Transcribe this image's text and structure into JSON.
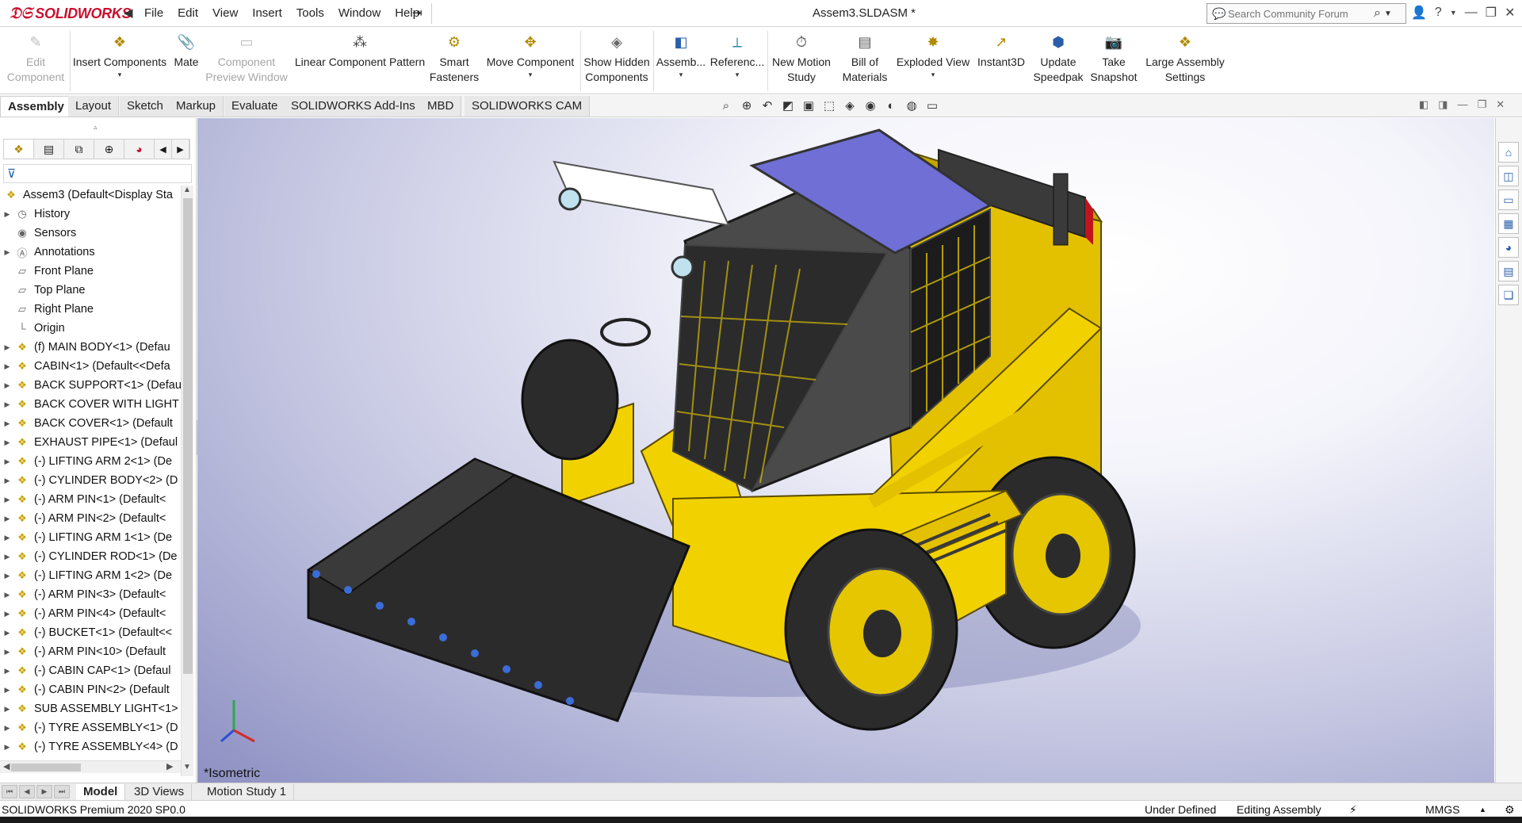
{
  "app": {
    "logo_text": "SOLIDWORKS",
    "document_title": "Assem3.SLDASM *"
  },
  "menu": {
    "items": [
      "File",
      "Edit",
      "View",
      "Insert",
      "Tools",
      "Window",
      "Help"
    ]
  },
  "search": {
    "placeholder": "Search Community Forum"
  },
  "ribbon": {
    "buttons": [
      {
        "label": "Edit\nComponent",
        "line1": "Edit",
        "line2": "Component",
        "enabled": false,
        "icon": "edit-component-icon"
      },
      {
        "label": "Insert Components",
        "line1": "Insert Components",
        "line2": "",
        "enabled": true,
        "icon": "insert-components-icon"
      },
      {
        "label": "Mate",
        "line1": "Mate",
        "line2": "",
        "enabled": true,
        "icon": "mate-icon"
      },
      {
        "label": "Component Preview Window",
        "line1": "Component",
        "line2": "Preview Window",
        "enabled": false,
        "icon": "component-preview-icon"
      },
      {
        "label": "Linear Component Pattern",
        "line1": "Linear Component Pattern",
        "line2": "",
        "enabled": true,
        "icon": "linear-pattern-icon"
      },
      {
        "label": "Smart Fasteners",
        "line1": "Smart",
        "line2": "Fasteners",
        "enabled": true,
        "icon": "smart-fasteners-icon"
      },
      {
        "label": "Move Component",
        "line1": "Move Component",
        "line2": "",
        "enabled": true,
        "icon": "move-component-icon"
      },
      {
        "label": "Show Hidden Components",
        "line1": "Show Hidden",
        "line2": "Components",
        "enabled": true,
        "icon": "show-hidden-icon"
      },
      {
        "label": "Assemb...",
        "line1": "Assemb...",
        "line2": "",
        "enabled": true,
        "icon": "assembly-features-icon"
      },
      {
        "label": "Referenc...",
        "line1": "Referenc...",
        "line2": "",
        "enabled": true,
        "icon": "reference-geometry-icon"
      },
      {
        "label": "New Motion Study",
        "line1": "New Motion",
        "line2": "Study",
        "enabled": true,
        "icon": "motion-study-icon"
      },
      {
        "label": "Bill of Materials",
        "line1": "Bill of",
        "line2": "Materials",
        "enabled": true,
        "icon": "bill-of-materials-icon"
      },
      {
        "label": "Exploded View",
        "line1": "Exploded View",
        "line2": "",
        "enabled": true,
        "icon": "exploded-view-icon"
      },
      {
        "label": "Instant3D",
        "line1": "Instant3D",
        "line2": "",
        "enabled": true,
        "icon": "instant3d-icon"
      },
      {
        "label": "Update Speedpak",
        "line1": "Update",
        "line2": "Speedpak",
        "enabled": true,
        "icon": "speedpak-icon"
      },
      {
        "label": "Take Snapshot",
        "line1": "Take",
        "line2": "Snapshot",
        "enabled": true,
        "icon": "snapshot-icon"
      },
      {
        "label": "Large Assembly Settings",
        "line1": "Large Assembly",
        "line2": "Settings",
        "enabled": true,
        "icon": "large-assembly-icon"
      }
    ]
  },
  "command_tabs": [
    "Assembly",
    "Layout",
    "Sketch",
    "Markup",
    "Evaluate",
    "SOLIDWORKS Add-Ins",
    "MBD",
    "SOLIDWORKS CAM"
  ],
  "active_command_tab": "Assembly",
  "feature_tree": {
    "root": "Assem3  (Default<Display Sta",
    "items": [
      {
        "label": "History",
        "icon": "history-icon",
        "expandable": true
      },
      {
        "label": "Sensors",
        "icon": "sensors-icon",
        "expandable": false
      },
      {
        "label": "Annotations",
        "icon": "annotations-icon",
        "expandable": true
      },
      {
        "label": "Front Plane",
        "icon": "plane-icon",
        "expandable": false
      },
      {
        "label": "Top Plane",
        "icon": "plane-icon",
        "expandable": false
      },
      {
        "label": "Right Plane",
        "icon": "plane-icon",
        "expandable": false
      },
      {
        "label": "Origin",
        "icon": "origin-icon",
        "expandable": false
      },
      {
        "label": "(f) MAIN BODY<1> (Defau",
        "icon": "component-icon",
        "expandable": true
      },
      {
        "label": "CABIN<1> (Default<<Defa",
        "icon": "component-icon",
        "expandable": true
      },
      {
        "label": "BACK SUPPORT<1> (Defau",
        "icon": "component-icon",
        "expandable": true
      },
      {
        "label": "BACK COVER WITH LIGHT",
        "icon": "component-icon",
        "expandable": true
      },
      {
        "label": "BACK COVER<1> (Default",
        "icon": "component-icon",
        "expandable": true
      },
      {
        "label": "EXHAUST PIPE<1> (Defaul",
        "icon": "component-icon",
        "expandable": true
      },
      {
        "label": "(-) LIFTING ARM 2<1> (De",
        "icon": "component-icon",
        "expandable": true
      },
      {
        "label": "(-) CYLINDER BODY<2> (D",
        "icon": "component-icon",
        "expandable": true
      },
      {
        "label": "(-) ARM PIN<1> (Default<",
        "icon": "component-icon",
        "expandable": true
      },
      {
        "label": "(-) ARM PIN<2> (Default<",
        "icon": "component-icon",
        "expandable": true
      },
      {
        "label": "(-) LIFTING ARM 1<1> (De",
        "icon": "component-icon",
        "expandable": true
      },
      {
        "label": "(-) CYLINDER ROD<1> (De",
        "icon": "component-icon",
        "expandable": true
      },
      {
        "label": "(-) LIFTING ARM 1<2> (De",
        "icon": "component-icon",
        "expandable": true
      },
      {
        "label": "(-) ARM PIN<3> (Default<",
        "icon": "component-icon",
        "expandable": true
      },
      {
        "label": "(-) ARM PIN<4> (Default<",
        "icon": "component-icon",
        "expandable": true
      },
      {
        "label": "(-) BUCKET<1> (Default<<",
        "icon": "component-icon",
        "expandable": true
      },
      {
        "label": "(-) ARM PIN<10> (Default",
        "icon": "component-icon",
        "expandable": true
      },
      {
        "label": "(-) CABIN CAP<1> (Defaul",
        "icon": "component-icon",
        "expandable": true
      },
      {
        "label": "(-) CABIN PIN<2> (Default",
        "icon": "component-icon",
        "expandable": true
      },
      {
        "label": "SUB ASSEMBLY LIGHT<1>",
        "icon": "subassembly-icon",
        "expandable": true
      },
      {
        "label": "(-) TYRE ASSEMBLY<1> (D",
        "icon": "subassembly-icon",
        "expandable": true
      },
      {
        "label": "(-) TYRE ASSEMBLY<4> (D",
        "icon": "subassembly-icon",
        "expandable": true
      }
    ]
  },
  "viewport": {
    "view_label": "*Isometric"
  },
  "bottom_tabs": [
    "Model",
    "3D Views",
    "Motion Study 1"
  ],
  "active_bottom_tab": "Model",
  "status": {
    "product": "SOLIDWORKS Premium 2020 SP0.0",
    "definition": "Under Defined",
    "mode": "Editing Assembly",
    "units": "MMGS"
  },
  "colors": {
    "brand_red": "#c8102e",
    "machine_yellow": "#f2d100",
    "bucket_dark": "#2b2b2b",
    "glass_blue": "#6f6fd6"
  }
}
